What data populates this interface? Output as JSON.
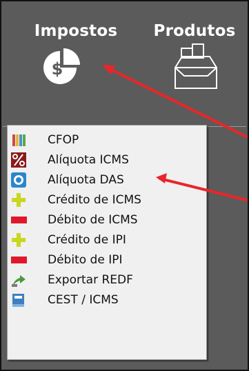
{
  "toolbar": {
    "impostos_label": "Impostos",
    "produtos_label": "Produtos"
  },
  "menu": {
    "items": [
      {
        "label": "CFOP",
        "icon": "colored-books-icon"
      },
      {
        "label": "Alíquota ICMS",
        "icon": "percent-icon"
      },
      {
        "label": "Alíquota DAS",
        "icon": "das-coin-icon"
      },
      {
        "label": "Crédito de ICMS",
        "icon": "plus-icon"
      },
      {
        "label": "Débito de ICMS",
        "icon": "minus-icon"
      },
      {
        "label": "Crédito de IPI",
        "icon": "plus-icon"
      },
      {
        "label": "Débito de IPI",
        "icon": "minus-icon"
      },
      {
        "label": "Exportar REDF",
        "icon": "export-arrow-icon"
      },
      {
        "label": "CEST / ICMS",
        "icon": "book-icon"
      }
    ]
  },
  "colors": {
    "toolbar_bg": "#5b5b5b",
    "menu_bg": "#f0f0f0",
    "annotation_arrow": "#e8262a",
    "plus_icon": "#c9d81e",
    "minus_icon": "#e0182a",
    "percent_icon_bg": "#8b1a1a"
  }
}
